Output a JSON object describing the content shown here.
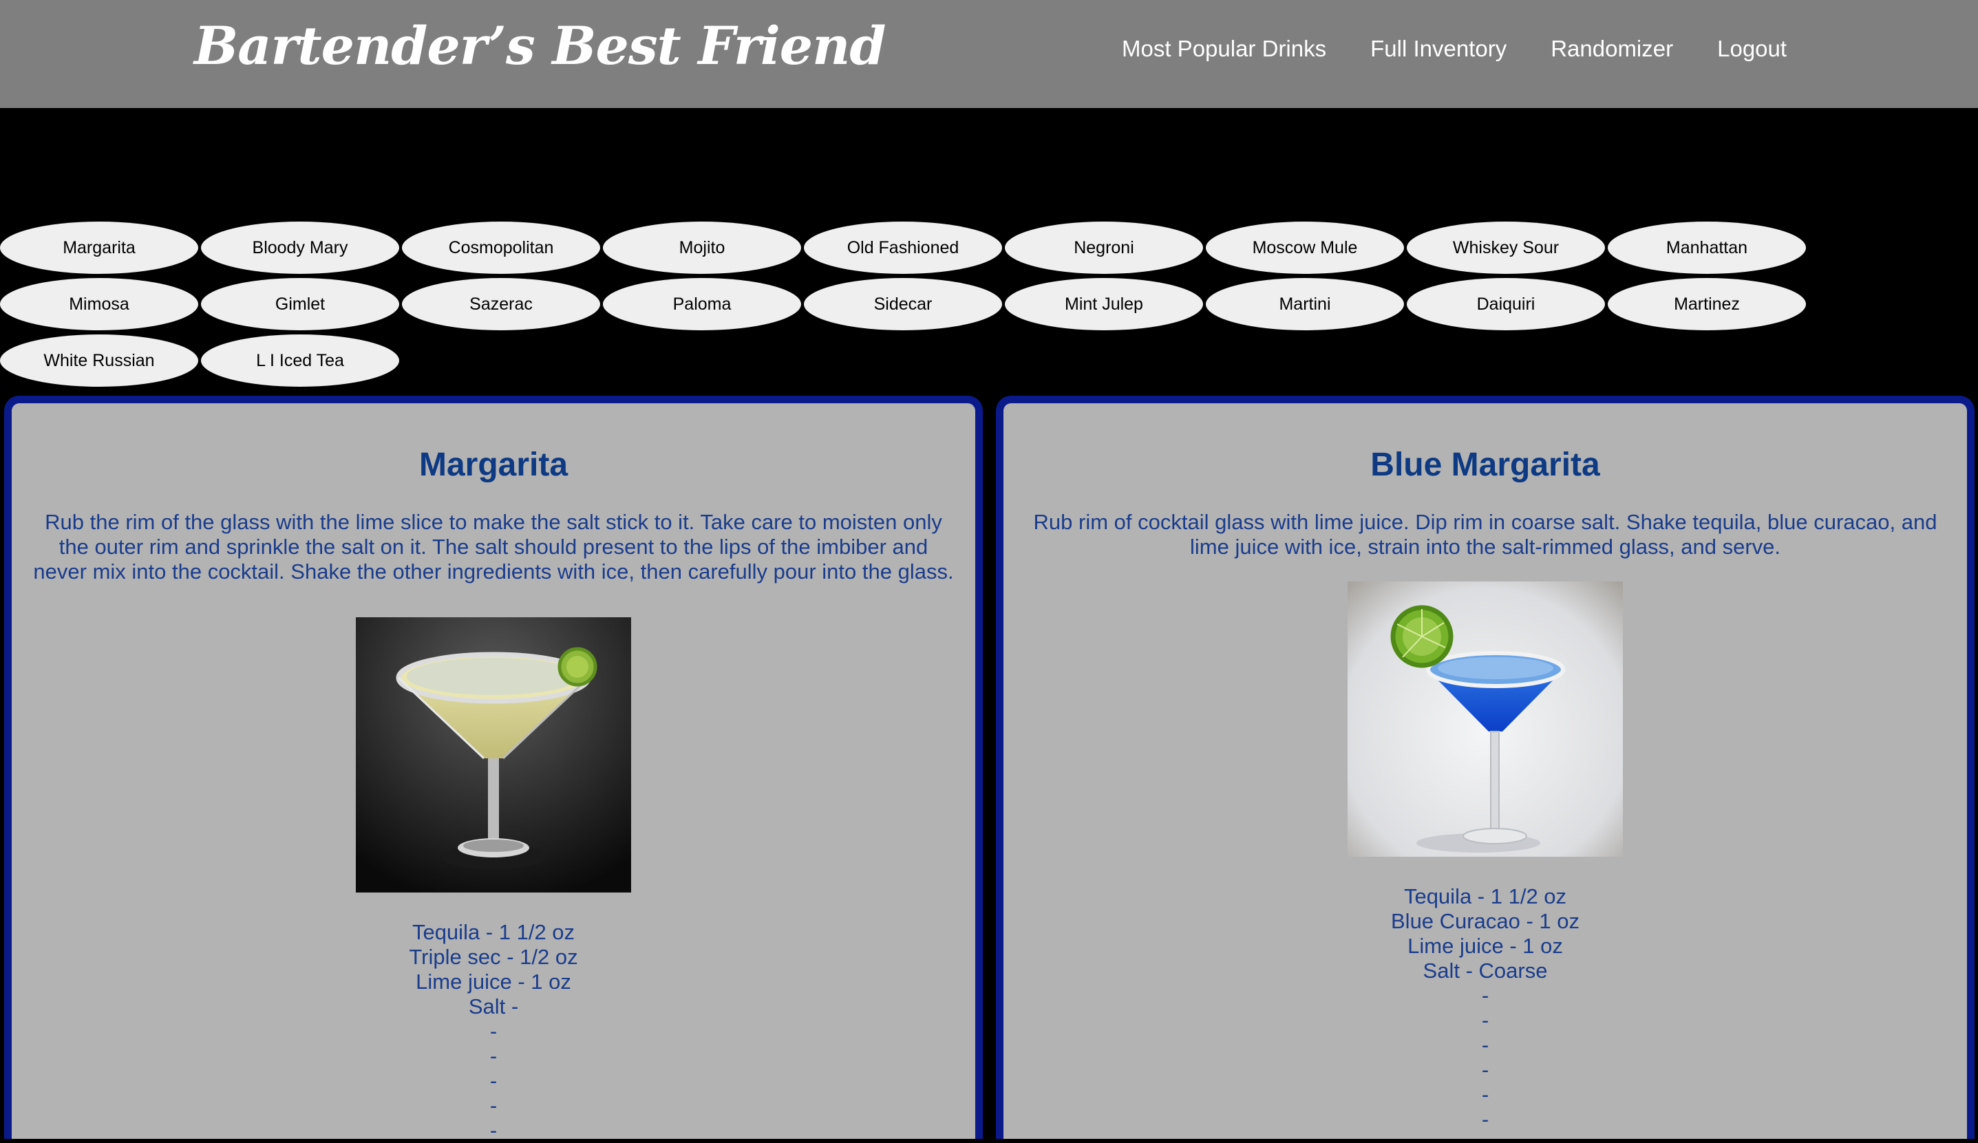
{
  "header": {
    "brand": "Bartender’s Best Friend",
    "nav": [
      "Most Popular Drinks",
      "Full Inventory",
      "Randomizer",
      "Logout"
    ]
  },
  "drinks": [
    [
      "Margarita",
      "Bloody Mary",
      "Cosmopolitan",
      "Mojito",
      "Old Fashioned",
      "Negroni",
      "Moscow Mule",
      "Whiskey Sour",
      "Manhattan"
    ],
    [
      "Mimosa",
      "Gimlet",
      "Sazerac",
      "Paloma",
      "Sidecar",
      "Mint Julep",
      "Martini",
      "Daiquiri",
      "Martinez"
    ],
    [
      "White Russian",
      "L I Iced Tea"
    ]
  ],
  "cards": [
    {
      "title": "Margarita",
      "instructions": "Rub the rim of the glass with the lime slice to make the salt stick to it. Take care to moisten only the outer rim and sprinkle the salt on it. The salt should present to the lips of the imbiber and never mix into the cocktail. Shake the other ingredients with ice, then carefully pour into the glass.",
      "ingredients": [
        "Tequila - 1 1/2 oz",
        "Triple sec - 1/2 oz",
        "Lime juice - 1 oz",
        "Salt -",
        "-",
        "-",
        "-",
        "-",
        "-"
      ]
    },
    {
      "title": "Blue Margarita",
      "instructions": "Rub rim of cocktail glass with lime juice. Dip rim in coarse salt. Shake tequila, blue curacao, and lime juice with ice, strain into the salt-rimmed glass, and serve.",
      "ingredients": [
        "Tequila - 1 1/2 oz",
        "Blue Curacao - 1 oz",
        "Lime juice - 1 oz",
        "Salt - Coarse",
        "-",
        "-",
        "-",
        "-",
        "-",
        "-"
      ]
    }
  ]
}
